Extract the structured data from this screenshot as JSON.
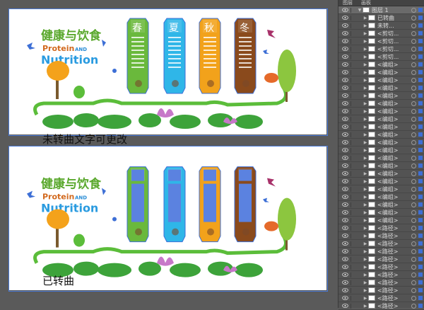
{
  "artboards": [
    {
      "caption": "未转曲文字可更改",
      "variant": "text"
    },
    {
      "caption": "已转曲",
      "variant": "outlined"
    }
  ],
  "design": {
    "title_cn": "健康与饮食",
    "title_en_1": "Protein",
    "title_en_and": "AND",
    "title_en_2": "Nutrition",
    "seasons": [
      "春",
      "夏",
      "秋",
      "冬"
    ],
    "season_colors": [
      "#6ab93c",
      "#2fb6e8",
      "#f2a21b",
      "#8a4a1c"
    ]
  },
  "layers_panel": {
    "tabs": [
      "图层",
      "画板"
    ],
    "rows": [
      {
        "label": "图层 1",
        "expanded": true,
        "indent": 0,
        "active": true
      },
      {
        "label": "已转曲",
        "indent": 1
      },
      {
        "label": "未转...",
        "indent": 1
      },
      {
        "label": "<剪切...",
        "indent": 1
      },
      {
        "label": "<剪切...",
        "indent": 1
      },
      {
        "label": "<剪切...",
        "indent": 1
      },
      {
        "label": "<剪切...",
        "indent": 1
      },
      {
        "label": "<编组>",
        "indent": 1
      },
      {
        "label": "<编组>",
        "indent": 1
      },
      {
        "label": "<编组>",
        "indent": 1
      },
      {
        "label": "<编组>",
        "indent": 1
      },
      {
        "label": "<编组>",
        "indent": 1
      },
      {
        "label": "<编组>",
        "indent": 1
      },
      {
        "label": "<编组>",
        "indent": 1
      },
      {
        "label": "<编组>",
        "indent": 1
      },
      {
        "label": "<编组>",
        "indent": 1
      },
      {
        "label": "<编组>",
        "indent": 1
      },
      {
        "label": "<编组>",
        "indent": 1
      },
      {
        "label": "<编组>",
        "indent": 1
      },
      {
        "label": "<编组>",
        "indent": 1
      },
      {
        "label": "<编组>",
        "indent": 1
      },
      {
        "label": "<编组>",
        "indent": 1
      },
      {
        "label": "<编组>",
        "indent": 1
      },
      {
        "label": "<编组>",
        "indent": 1
      },
      {
        "label": "<编组>",
        "indent": 1
      },
      {
        "label": "<编组>",
        "indent": 1
      },
      {
        "label": "<编组>",
        "indent": 1
      },
      {
        "label": "<编组>",
        "indent": 1
      },
      {
        "label": "<路径>",
        "indent": 1
      },
      {
        "label": "<路径>",
        "indent": 1
      },
      {
        "label": "<路径>",
        "indent": 1
      },
      {
        "label": "<路径>",
        "indent": 1
      },
      {
        "label": "<路径>",
        "indent": 1
      },
      {
        "label": "<路径>",
        "indent": 1
      },
      {
        "label": "<路径>",
        "indent": 1
      },
      {
        "label": "<路径>",
        "indent": 1
      },
      {
        "label": "<路径>",
        "indent": 1
      },
      {
        "label": "<路径>",
        "indent": 1
      },
      {
        "label": "<路径>",
        "indent": 1
      }
    ]
  },
  "icons": {
    "visibility": "eye-icon",
    "expand": "disclosure-triangle-icon",
    "target": "target-circle-icon"
  }
}
